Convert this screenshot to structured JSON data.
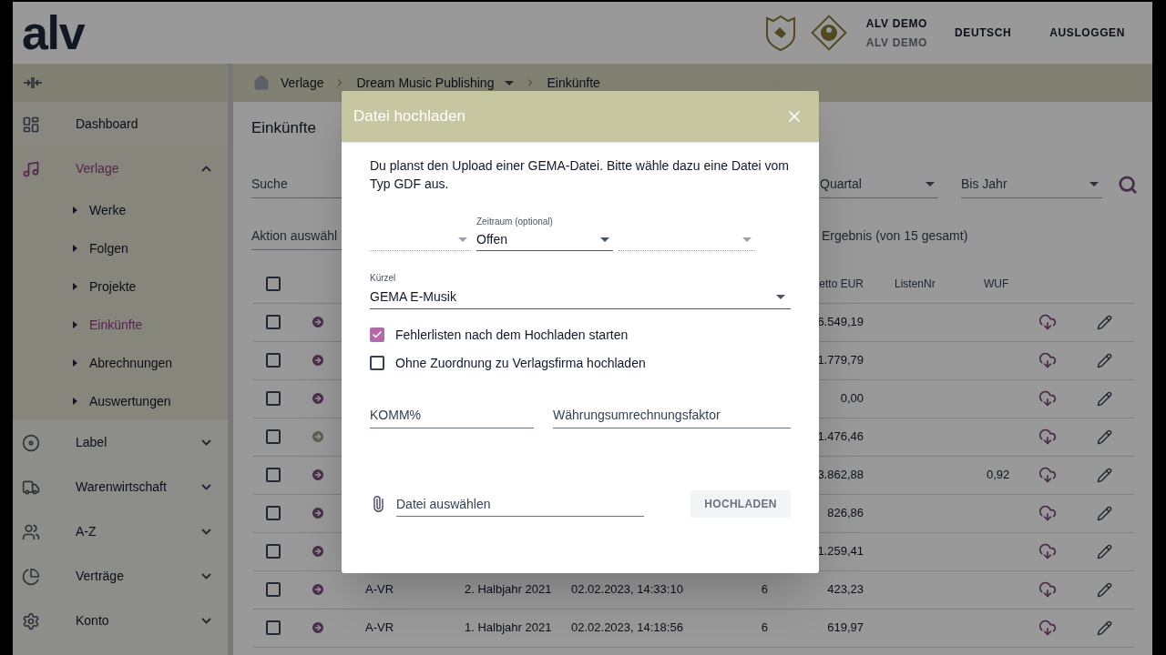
{
  "header": {
    "logo": "alv",
    "user": {
      "name": "ALV DEMO",
      "subtitle": "ALV DEMO"
    },
    "language": "DEUTSCH",
    "logout": "AUSLOGGEN"
  },
  "sidebar": {
    "items": [
      {
        "kind": "link",
        "label": "Dashboard",
        "selected": false
      },
      {
        "kind": "group",
        "label": "Verlage",
        "selected": true,
        "expanded": true,
        "children": [
          {
            "label": "Werke",
            "selected": false
          },
          {
            "label": "Folgen",
            "selected": false
          },
          {
            "label": "Projekte",
            "selected": false
          },
          {
            "label": "Einkünfte",
            "selected": true
          },
          {
            "label": "Abrechnungen",
            "selected": false
          },
          {
            "label": "Auswertungen",
            "selected": false
          }
        ]
      },
      {
        "kind": "group",
        "label": "Label",
        "selected": false,
        "expanded": false
      },
      {
        "kind": "group",
        "label": "Warenwirtschaft",
        "selected": false,
        "expanded": false
      },
      {
        "kind": "group",
        "label": "A-Z",
        "selected": false,
        "expanded": false
      },
      {
        "kind": "group",
        "label": "Verträge",
        "selected": false,
        "expanded": false
      },
      {
        "kind": "group",
        "label": "Konto",
        "selected": false,
        "expanded": false
      }
    ]
  },
  "breadcrumb": [
    "Verlage",
    "Dream Music Publishing",
    "Einkünfte"
  ],
  "page": {
    "title": "Einkünfte",
    "search": {
      "placeholder": "Suche"
    },
    "quarter": {
      "placeholder": "Quartal"
    },
    "to_year": {
      "placeholder": "Bis Jahr"
    },
    "action": {
      "placeholder": "Aktion auswähl"
    },
    "result_count": "Ergebnis (von 15 gesamt)"
  },
  "table": {
    "select_all": {
      "checked": false
    },
    "columns": [
      "etto EUR",
      "ListenNr",
      "WUF"
    ],
    "rows": [
      {
        "checked": false,
        "active": true,
        "cells": {
          "netto": "6.549,19"
        }
      },
      {
        "checked": false,
        "active": true,
        "cells": {
          "netto": "1.779,79"
        }
      },
      {
        "checked": false,
        "active": true,
        "cells": {
          "netto": "0,00"
        }
      },
      {
        "checked": false,
        "active": false,
        "cells": {
          "netto": "1.476,46"
        }
      },
      {
        "checked": false,
        "active": true,
        "cells": {
          "netto": "3.862,88",
          "wuf": "0,92"
        }
      },
      {
        "checked": false,
        "active": true,
        "cells": {
          "netto": "826,86"
        }
      },
      {
        "checked": false,
        "active": true,
        "cells": {
          "netto": "1.259,41"
        }
      },
      {
        "checked": false,
        "active": true,
        "cells": {
          "code": "A-VR",
          "period": "2. Halbjahr 2021",
          "date": "02.02.2023, 14:33:10",
          "count": "6",
          "netto": "423,23"
        }
      },
      {
        "checked": false,
        "active": true,
        "cells": {
          "code": "A-VR",
          "period": "1. Halbjahr 2021",
          "date": "02.02.2023, 14:18:56",
          "count": "6",
          "netto": "619,97"
        }
      }
    ]
  },
  "dialog": {
    "title": "Datei hochladen",
    "description": "Du planst den Upload einer GEMA-Datei. Bitte wähle dazu eine Datei vom Typ GDF aus.",
    "period_selects": [
      {
        "disabled": true
      },
      {
        "disabled": false,
        "label": "Zeitraum (optional)",
        "value": "Offen"
      },
      {
        "disabled": true
      }
    ],
    "kuerzel": {
      "label": "Kürzel",
      "value": "GEMA E-Musik"
    },
    "options": [
      {
        "label": "Fehlerlisten nach dem Hochladen starten",
        "checked": true
      },
      {
        "label": "Ohne Zuordnung zu Verlagsfirma hochladen",
        "checked": false
      }
    ],
    "fields": [
      {
        "placeholder": "KOMM%"
      },
      {
        "placeholder": "Währungsumrechnungsfaktor"
      }
    ],
    "file": {
      "placeholder": "Datei auswählen"
    },
    "upload_button": {
      "label": "HOCHLADEN",
      "disabled": true
    }
  }
}
